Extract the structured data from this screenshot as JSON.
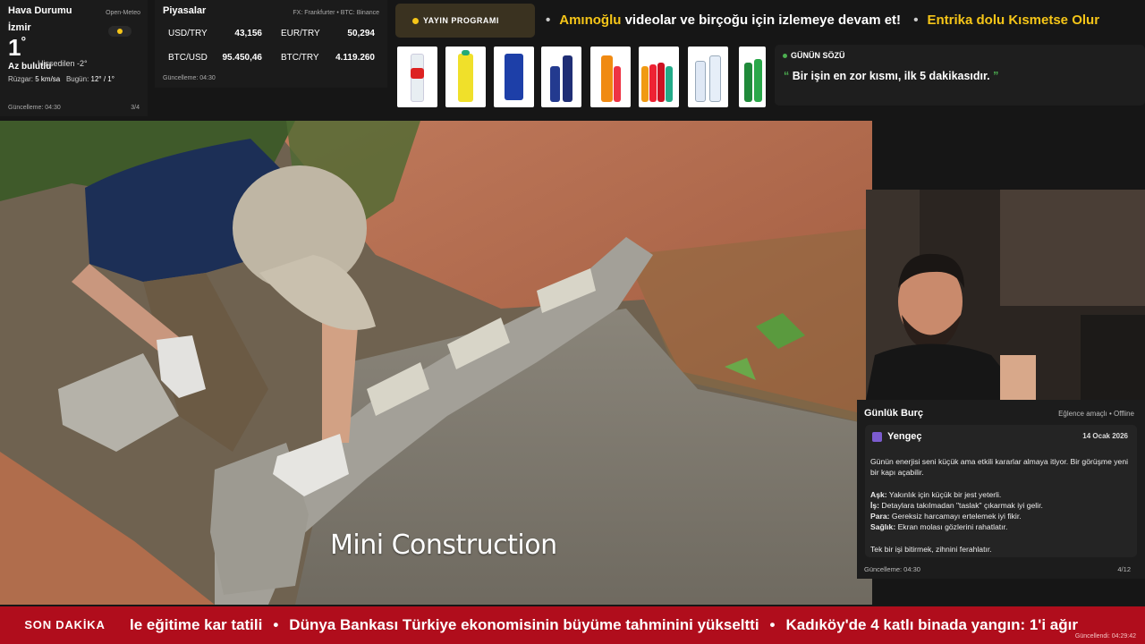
{
  "weather": {
    "title": "Hava Durumu",
    "source": "Open-Meteo",
    "city": "İzmir",
    "temperature": "1",
    "degree_symbol": "°",
    "feels_like": "Hissedilen -2°",
    "condition": "Az bulutlu",
    "wind_label": "Rüzgar:",
    "wind_value": "5 km/sa",
    "today_label": "Bugün:",
    "today_value": "12° / 1°",
    "updated": "Güncelleme: 04:30",
    "page": "3/4",
    "icon": "partly-cloudy-icon"
  },
  "markets": {
    "title": "Piyasalar",
    "source": "FX: Frankfurter • BTC: Binance",
    "rows": [
      {
        "pair": "USD/TRY",
        "value": "43,156"
      },
      {
        "pair": "EUR/TRY",
        "value": "50,294"
      },
      {
        "pair": "BTC/USD",
        "value": "95.450,46"
      },
      {
        "pair": "BTC/TRY",
        "value": "4.119.260"
      }
    ],
    "updated": "Güncelleme: 04:30"
  },
  "schedule": {
    "label": "YAYIN PROGRAMI",
    "ticker": [
      {
        "highlight": "Amınoğlu",
        "text": " videolar ve birçoğu için izlemeye devam et!"
      },
      {
        "highlight": "Entrika dolu Kısmetse Olur",
        "text": ""
      }
    ]
  },
  "products": [
    "water-bottle",
    "lemon-soda",
    "can-drink",
    "blue-bottle",
    "orange-soda",
    "soda-pack",
    "water-pack",
    "green-soda"
  ],
  "quote": {
    "label": "GÜNÜN SÖZÜ",
    "open": "“",
    "text": " Bir işin en zor kısmı, ilk 5 dakikasıdır. ",
    "close": "”"
  },
  "video": {
    "caption": "Mini Construction"
  },
  "horoscope": {
    "title": "Günlük Burç",
    "tag": "Eğlence amaçlı • Offline",
    "sign": "Yengeç",
    "date": "14 Ocak 2026",
    "intro": "Günün enerjisi seni küçük ama etkili kararlar almaya itiyor. Bir görüşme yeni bir kapı açabilir.",
    "lines": [
      {
        "label": "Aşk:",
        "text": " Yakınlık için küçük bir jest yeterli."
      },
      {
        "label": "İş:",
        "text": " Detaylara takılmadan \"taslak\" çıkarmak iyi gelir."
      },
      {
        "label": "Para:",
        "text": " Gereksiz harcamayı ertelemek iyi fikir."
      },
      {
        "label": "Sağlık:",
        "text": " Ekran molası gözlerini rahatlatır."
      }
    ],
    "outro": "Tek bir işi bitirmek, zihnini ferahlatır.",
    "updated": "Güncelleme: 04:30",
    "page": "4/12"
  },
  "news": {
    "label": "SON DAKİKA",
    "items": [
      "le eğitime kar tatili",
      "Dünya Bankası Türkiye ekonomisinin büyüme tahminini yükseltti",
      "Kadıköy'de 4 katlı binada yangın: 1'i ağır"
    ],
    "separator": "•",
    "updated": "Güncellendi: 04:29:42"
  },
  "colors": {
    "accent_yellow": "#f5c518",
    "quote_green": "#4caf50",
    "news_red": "#b00d1c",
    "panel_bg": "#1b1b1b"
  }
}
